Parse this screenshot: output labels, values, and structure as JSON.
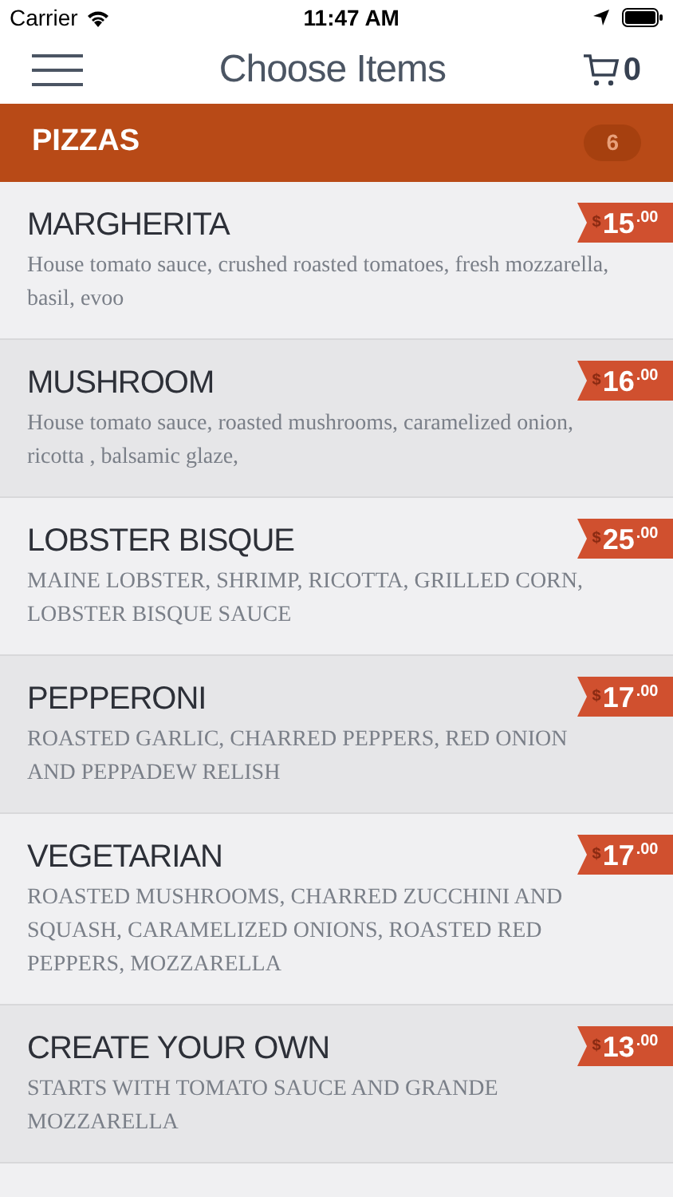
{
  "status_bar": {
    "carrier": "Carrier",
    "time": "11:47 AM"
  },
  "header": {
    "title": "Choose Items",
    "cart_count": "0"
  },
  "section": {
    "title": "PIZZAS",
    "count": "6"
  },
  "items": [
    {
      "name": "MARGHERITA",
      "description": "House tomato sauce, crushed roasted tomatoes, fresh mozzarella, basil, evoo",
      "currency": "$",
      "price": "15",
      "cents": ".00"
    },
    {
      "name": "MUSHROOM",
      "description": "House tomato sauce, roasted mushrooms, caramelized onion, ricotta , balsamic glaze,",
      "currency": "$",
      "price": "16",
      "cents": ".00"
    },
    {
      "name": "LOBSTER BISQUE",
      "description": "MAINE LOBSTER, SHRIMP, RICOTTA, GRILLED CORN, LOBSTER BISQUE SAUCE",
      "currency": "$",
      "price": "25",
      "cents": ".00"
    },
    {
      "name": "PEPPERONI",
      "description": "ROASTED GARLIC, CHARRED PEPPERS, RED ONION AND PEPPADEW RELISH",
      "currency": "$",
      "price": "17",
      "cents": ".00"
    },
    {
      "name": "VEGETARIAN",
      "description": "ROASTED MUSHROOMS, CHARRED ZUCCHINI AND SQUASH, CARAMELIZED ONIONS, ROASTED RED PEPPERS, MOZZARELLA",
      "currency": "$",
      "price": "17",
      "cents": ".00"
    },
    {
      "name": "CREATE YOUR OWN",
      "description": "STARTS WITH TOMATO SAUCE AND GRANDE MOZZARELLA",
      "currency": "$",
      "price": "13",
      "cents": ".00"
    }
  ]
}
